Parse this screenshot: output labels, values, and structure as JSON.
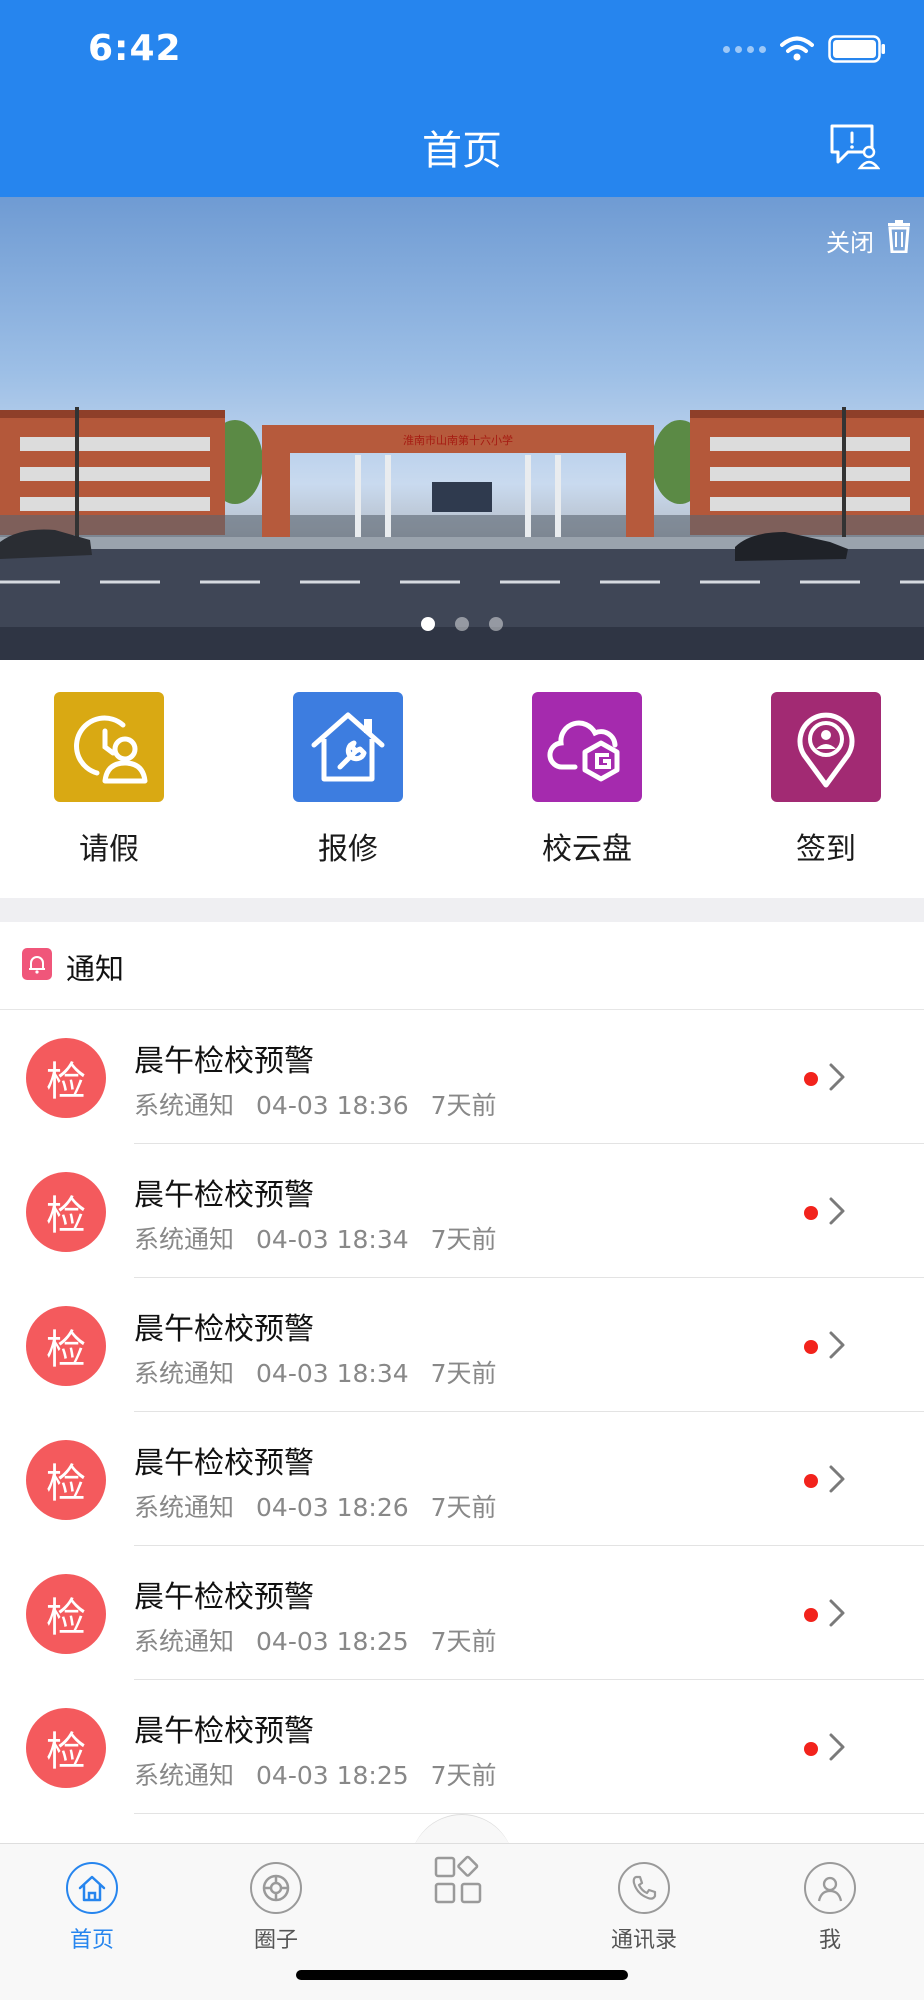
{
  "status": {
    "time": "6:42"
  },
  "header": {
    "title": "首页",
    "bg_color": "#2685EE"
  },
  "banner": {
    "close_label": "关闭",
    "gate_sign": "淮南市山南第十六小学",
    "slide_count": 3,
    "active_slide": 1
  },
  "actions": [
    {
      "label": "请假",
      "icon": "leave-clock-person-icon",
      "color": "#D9A913"
    },
    {
      "label": "报修",
      "icon": "repair-house-wrench-icon",
      "color": "#3D7DE0"
    },
    {
      "label": "校云盘",
      "icon": "cloud-drive-icon",
      "color": "#A52AAE"
    },
    {
      "label": "签到",
      "icon": "location-pin-person-icon",
      "color": "#A22A73"
    }
  ],
  "notice": {
    "title": "通知",
    "badge_color": "#F0567A"
  },
  "notices": [
    {
      "avatar": "检",
      "title": "晨午检校预警",
      "source": "系统通知",
      "datetime": "04-03 18:36",
      "ago": "7天前"
    },
    {
      "avatar": "检",
      "title": "晨午检校预警",
      "source": "系统通知",
      "datetime": "04-03 18:34",
      "ago": "7天前"
    },
    {
      "avatar": "检",
      "title": "晨午检校预警",
      "source": "系统通知",
      "datetime": "04-03 18:34",
      "ago": "7天前"
    },
    {
      "avatar": "检",
      "title": "晨午检校预警",
      "source": "系统通知",
      "datetime": "04-03 18:26",
      "ago": "7天前"
    },
    {
      "avatar": "检",
      "title": "晨午检校预警",
      "source": "系统通知",
      "datetime": "04-03 18:25",
      "ago": "7天前"
    },
    {
      "avatar": "检",
      "title": "晨午检校预警",
      "source": "系统通知",
      "datetime": "04-03 18:25",
      "ago": "7天前"
    }
  ],
  "tabbar": {
    "items": [
      {
        "label": "首页",
        "icon": "home-icon",
        "active": true
      },
      {
        "label": "圈子",
        "icon": "circle-icon",
        "active": false
      },
      {
        "label": "",
        "icon": "apps-grid-icon",
        "active": false
      },
      {
        "label": "通讯录",
        "icon": "phone-icon",
        "active": false
      },
      {
        "label": "我",
        "icon": "user-icon",
        "active": false
      }
    ],
    "active_color": "#2685EE"
  }
}
